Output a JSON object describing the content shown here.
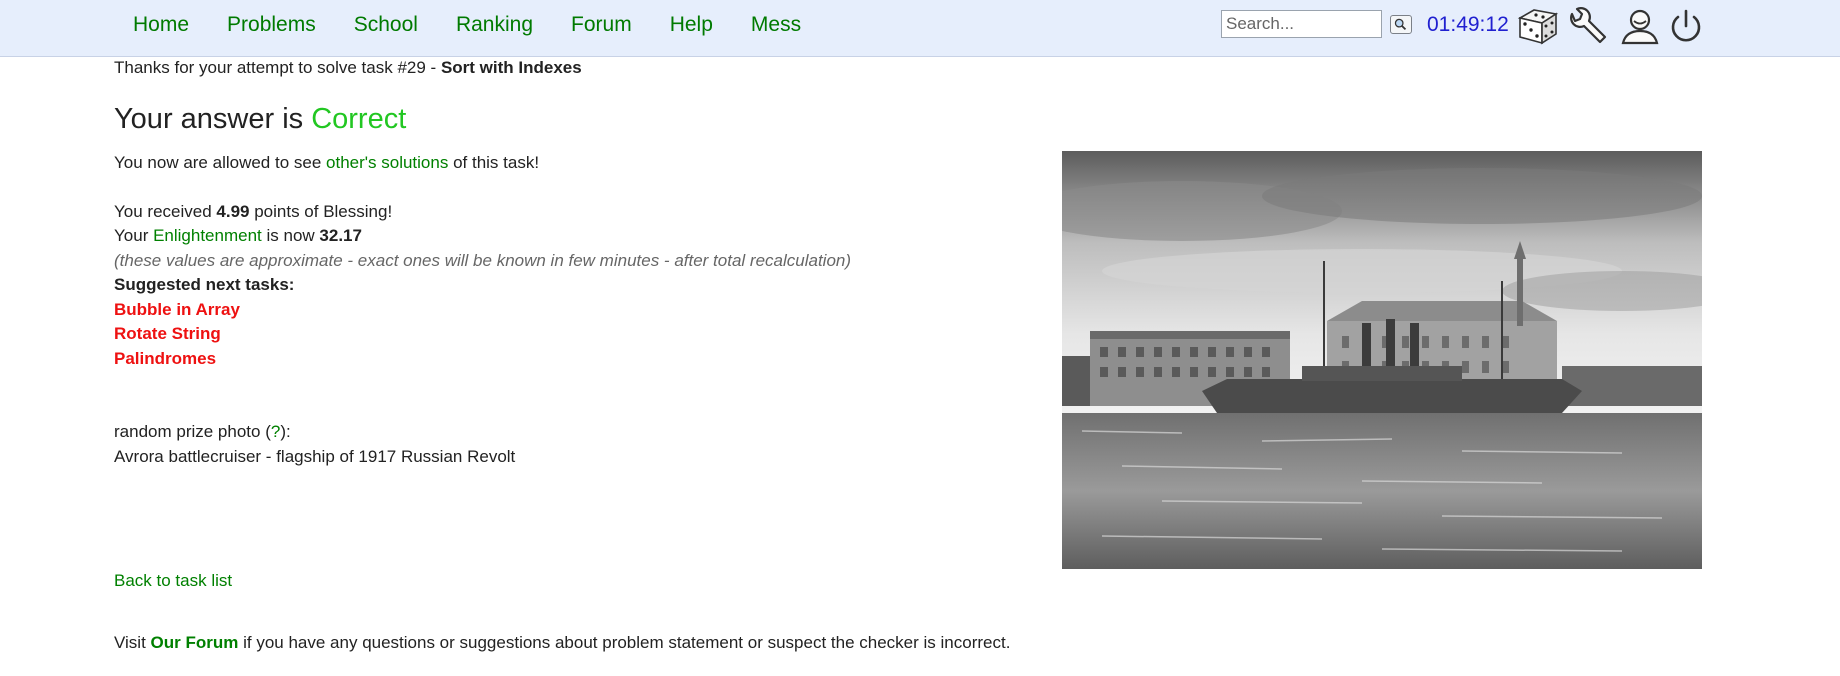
{
  "nav": {
    "items": [
      {
        "label": "Home"
      },
      {
        "label": "Problems"
      },
      {
        "label": "School"
      },
      {
        "label": "Ranking"
      },
      {
        "label": "Forum"
      },
      {
        "label": "Help"
      },
      {
        "label": "Mess"
      }
    ]
  },
  "search": {
    "placeholder": "Search..."
  },
  "clock": "01:49:12",
  "toolbar_icons": [
    "dice-icon",
    "wrench-icon",
    "user-icon",
    "power-icon"
  ],
  "result": {
    "thanks_prefix": "Thanks for your attempt to solve task #29 - ",
    "task_name": "Sort with Indexes",
    "verdict_prefix": "Your answer is ",
    "verdict": "Correct",
    "allowed_prefix": "You now are allowed to see ",
    "allowed_link": "other's solutions",
    "allowed_suffix": " of this task!",
    "received_prefix": "You received ",
    "points": "4.99",
    "received_suffix": " points of Blessing!",
    "enl_prefix": "Your ",
    "enl_link": "Enlightenment",
    "enl_middle": " is now ",
    "enl_value": "32.17",
    "note": "(these values are approximate - exact ones will be known in few minutes - after total recalculation)",
    "suggested_heading": "Suggested next tasks:",
    "suggested_tasks": [
      "Bubble in Array",
      "Rotate String",
      "Palindromes"
    ]
  },
  "prize": {
    "label_prefix": "random prize photo (",
    "help_link": "?",
    "label_suffix": "):",
    "caption": "Avrora battlecruiser - flagship of 1917 Russian Revolt"
  },
  "back_link": "Back to task list",
  "forum_note": {
    "prefix": "Visit ",
    "link": "Our Forum",
    "suffix": " if you have any questions or suggestions about problem statement or suspect the checker is incorrect."
  },
  "colors": {
    "nav_link": "#007a00",
    "correct": "#22c722",
    "task_link": "#ee1111",
    "clock": "#2020d0",
    "topbar_bg": "#e6eefc"
  }
}
